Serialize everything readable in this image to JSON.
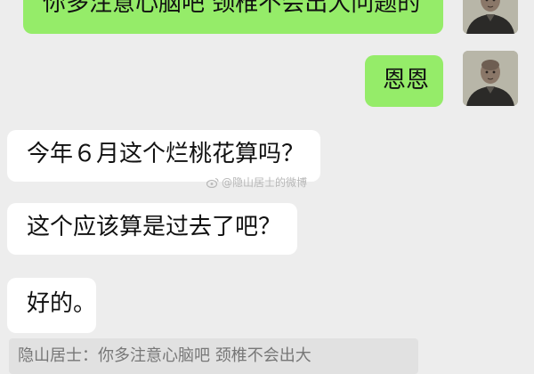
{
  "messages": [
    {
      "direction": "outgoing",
      "text": "你多注意心脑吧  颈椎不会出大问题的"
    },
    {
      "direction": "outgoing",
      "text": "恩恩"
    },
    {
      "direction": "incoming",
      "text": "今年６月这个烂桃花算吗？"
    },
    {
      "direction": "incoming",
      "text": "这个应该算是过去了吧？"
    },
    {
      "direction": "incoming",
      "text": "好的。"
    }
  ],
  "quote": {
    "text": "隐山居士：你多注意心脑吧  颈椎不会出大"
  },
  "watermark": {
    "text": "@隐山居士的微博"
  },
  "colors": {
    "background": "#ededed",
    "outgoing_bubble": "#95ec69",
    "incoming_bubble": "#ffffff",
    "quote_background": "#e1e1e1"
  },
  "icons": {
    "avatar": "avatar-icon",
    "watermark": "weibo-icon"
  }
}
